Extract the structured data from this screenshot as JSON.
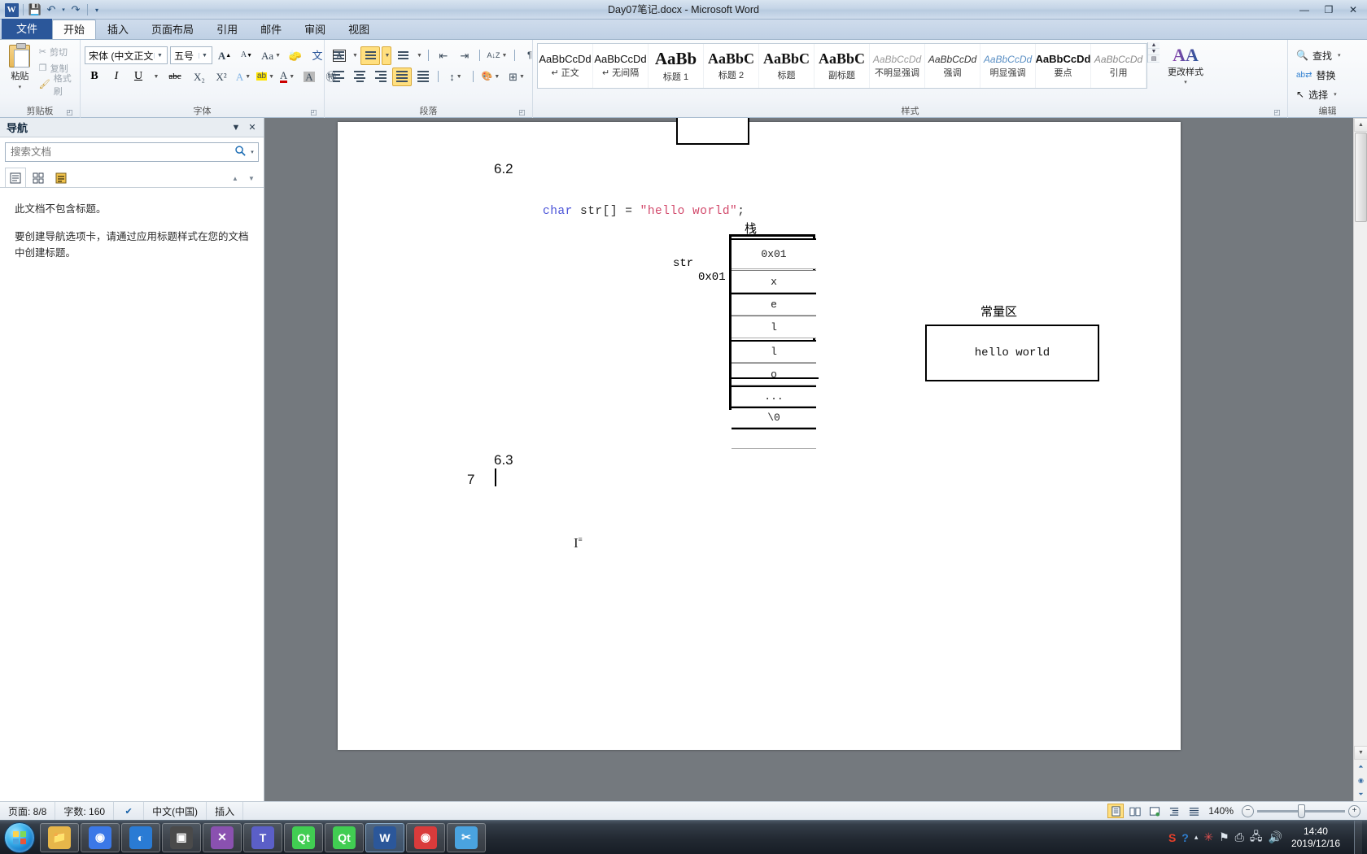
{
  "window": {
    "title": "Day07笔记.docx - Microsoft Word",
    "minimize": "—",
    "maximize": "❐",
    "close": "✕"
  },
  "quick_access": {
    "app_icon": "W",
    "save": "💾",
    "undo": "↶",
    "undo_caret": "▾",
    "redo": "↷",
    "customize": "▾"
  },
  "ribbon": {
    "tabs": [
      {
        "label": "文件",
        "name": "tab-file"
      },
      {
        "label": "开始",
        "name": "tab-home"
      },
      {
        "label": "插入",
        "name": "tab-insert"
      },
      {
        "label": "页面布局",
        "name": "tab-page-layout"
      },
      {
        "label": "引用",
        "name": "tab-references"
      },
      {
        "label": "邮件",
        "name": "tab-mailings"
      },
      {
        "label": "审阅",
        "name": "tab-review"
      },
      {
        "label": "视图",
        "name": "tab-view"
      }
    ],
    "active_tab": "开始",
    "clipboard": {
      "group_label": "剪贴板",
      "paste": "粘贴",
      "paste_caret": "▾",
      "cut": "剪切",
      "copy": "复制",
      "format_painter": "格式刷"
    },
    "font": {
      "group_label": "字体",
      "font_name": "宋体 (中文正文",
      "font_size": "五号",
      "grow_font": "A",
      "shrink_font": "A",
      "change_case": "Aa",
      "clear_format": "🧹",
      "phonetic": "文",
      "char_border": "A",
      "bold": "B",
      "italic": "I",
      "underline": "U",
      "strikethrough": "abc",
      "subscript": "X₂",
      "superscript": "X²",
      "text_effects": "A",
      "highlight": "ab",
      "font_color": "A",
      "char_shading": "A",
      "enclose_char": "㊕"
    },
    "paragraph": {
      "group_label": "段落",
      "bullets": "☰",
      "numbering": "☰",
      "multilevel": "☰",
      "decrease_indent": "⇤",
      "increase_indent": "⇥",
      "sort": "A↓Z",
      "show_marks": "¶",
      "align_left": "☰",
      "align_center": "☰",
      "align_right": "☰",
      "justify": "☰",
      "distribute": "☰",
      "line_spacing": "↕",
      "shading": "🎨",
      "borders": "⊞"
    },
    "styles": {
      "group_label": "样式",
      "items": [
        {
          "sample": "AaBbCcDd",
          "name": "↵ 正文"
        },
        {
          "sample": "AaBbCcDd",
          "name": "↵ 无间隔"
        },
        {
          "sample": "AaBb",
          "name": "标题 1"
        },
        {
          "sample": "AaBbC",
          "name": "标题 2"
        },
        {
          "sample": "AaBbC",
          "name": "标题"
        },
        {
          "sample": "AaBbC",
          "name": "副标题"
        },
        {
          "sample": "AaBbCcDd",
          "name": "不明显强调"
        },
        {
          "sample": "AaBbCcDd",
          "name": "强调"
        },
        {
          "sample": "AaBbCcDd",
          "name": "明显强调"
        },
        {
          "sample": "AaBbCcDd",
          "name": "要点"
        },
        {
          "sample": "AaBbCcDd",
          "name": "引用"
        }
      ],
      "scroll_up": "▲",
      "scroll_down": "▼",
      "more": "▤",
      "change_styles": "更改样式",
      "change_styles_caret": "▾"
    },
    "editing": {
      "group_label": "编辑",
      "find": "查找",
      "find_caret": "▾",
      "replace": "替换",
      "select": "选择",
      "select_caret": "▾"
    }
  },
  "navigation_pane": {
    "title": "导航",
    "dropdown": "▼",
    "close": "✕",
    "search_placeholder": "搜索文档",
    "search_value": "",
    "search_icon": "🔍",
    "search_caret": "▾",
    "tabs": [
      {
        "name": "headings-tab",
        "glyph": "▤"
      },
      {
        "name": "pages-tab",
        "glyph": "▦"
      },
      {
        "name": "results-tab",
        "glyph": "▣"
      }
    ],
    "prev": "▲",
    "next": "▼",
    "message_1": "此文档不包含标题。",
    "message_2": "要创建导航选项卡，请通过应用标题样式在您的文档中创建标题。"
  },
  "document": {
    "heading_62": "6.2",
    "heading_63": "6.3",
    "heading_7": "7",
    "code": {
      "keyword": "char",
      "identifier": " str[] = ",
      "string": "\"hello world\"",
      "terminator": ";"
    },
    "stack_label": "栈",
    "pointer_label": "str",
    "pointer_value": "0x01",
    "stack_cells": [
      "0x01",
      "x",
      "e",
      "l",
      "l",
      "o",
      "...",
      "\\0",
      ""
    ],
    "constant_area_label": "常量区",
    "constant_area_value": "hello world"
  },
  "status_bar": {
    "page": "页面: 8/8",
    "word_count": "字数: 160",
    "proofing_icon": "✔",
    "language": "中文(中国)",
    "insert_mode": "插入",
    "view_buttons": [
      {
        "name": "print-layout-view",
        "glyph": "▤",
        "selected": true
      },
      {
        "name": "full-screen-reading-view",
        "glyph": "📖",
        "selected": false
      },
      {
        "name": "web-layout-view",
        "glyph": "▥",
        "selected": false
      },
      {
        "name": "outline-view",
        "glyph": "☰",
        "selected": false
      },
      {
        "name": "draft-view",
        "glyph": "▤",
        "selected": false
      }
    ],
    "zoom": "140%",
    "zoom_out": "−",
    "zoom_in": "+"
  },
  "taskbar": {
    "start": "start-orb",
    "items": [
      {
        "name": "explorer",
        "glyph": "📁",
        "color": "#e7b64a",
        "running": true
      },
      {
        "name": "chrome",
        "glyph": "◉",
        "color": "#3b78e7",
        "running": true
      },
      {
        "name": "firefox-dev",
        "glyph": "◐",
        "color": "#2a7bd4",
        "running": true
      },
      {
        "name": "terminal",
        "glyph": "▣",
        "color": "#4a4a4a",
        "running": true
      },
      {
        "name": "visual-studio",
        "glyph": "✕",
        "color": "#8a51b0",
        "running": true
      },
      {
        "name": "teams",
        "glyph": "T",
        "color": "#5b5fc7",
        "running": true
      },
      {
        "name": "qt-creator-1",
        "glyph": "Qt",
        "color": "#41cd52",
        "running": true
      },
      {
        "name": "qt-creator-2",
        "glyph": "Qt",
        "color": "#41cd52",
        "running": true
      },
      {
        "name": "word",
        "glyph": "W",
        "color": "#2b579a",
        "running": true,
        "active": true
      },
      {
        "name": "media-player",
        "glyph": "◉",
        "color": "#d93b3b",
        "running": true
      },
      {
        "name": "snip-tool",
        "glyph": "✂",
        "color": "#4aa3df",
        "running": true
      }
    ],
    "tray": [
      {
        "name": "sogou-input-icon",
        "glyph": "S",
        "color": "#e8402a"
      },
      {
        "name": "help-icon",
        "glyph": "?",
        "color": "#2f7fd0"
      },
      {
        "name": "tray-expand-icon",
        "glyph": "▴",
        "color": "#cfd8e0"
      },
      {
        "name": "antivirus-icon",
        "glyph": "✳",
        "color": "#e05050"
      },
      {
        "name": "flag-action-center-icon",
        "glyph": "⚑",
        "color": "#e0e6ec"
      },
      {
        "name": "removable-media-icon",
        "glyph": "⎙",
        "color": "#dfe7ef"
      },
      {
        "name": "network-icon",
        "glyph": "🖧",
        "color": "#dfe7ef"
      },
      {
        "name": "volume-icon",
        "glyph": "🔊",
        "color": "#dfe7ef"
      }
    ],
    "clock_time": "14:40",
    "clock_date": "2019/12/16"
  },
  "colors": {
    "accent": "#2b579a",
    "highlight": "#ffdf7f",
    "keyword": "#4a53d8",
    "string": "#d2496b"
  }
}
